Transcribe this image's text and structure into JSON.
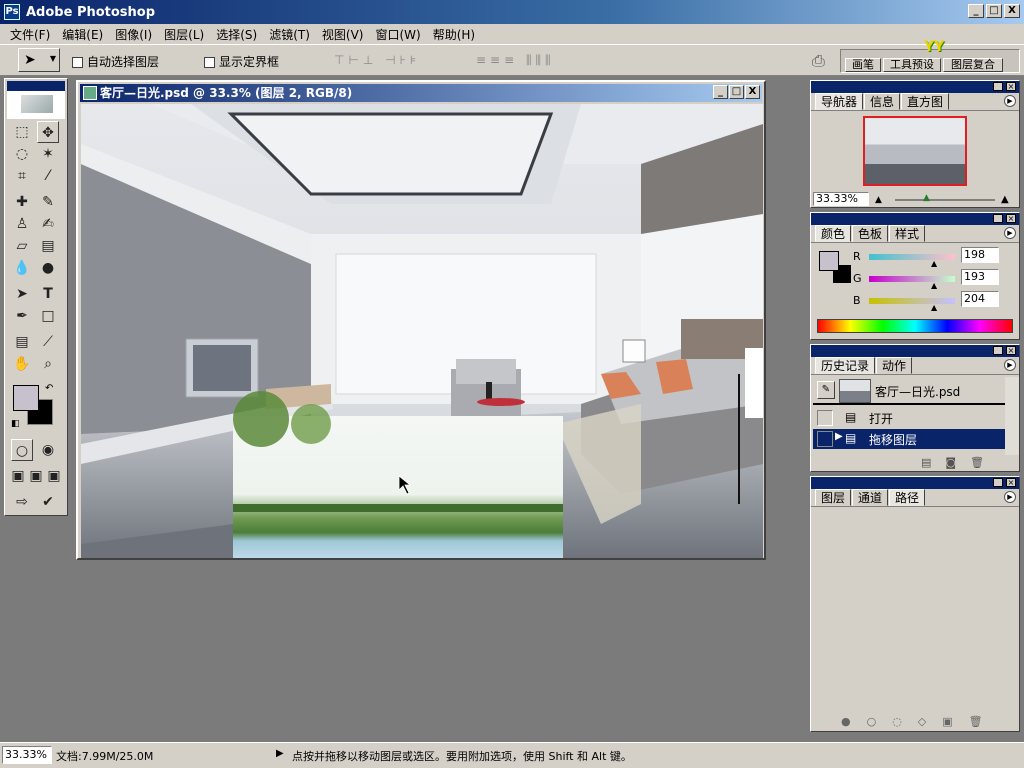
{
  "app": {
    "title": "Adobe Photoshop",
    "win_min": "_",
    "win_max": "□",
    "win_close": "X"
  },
  "menu": [
    "文件(F)",
    "编辑(E)",
    "图像(I)",
    "图层(L)",
    "选择(S)",
    "滤镜(T)",
    "视图(V)",
    "窗口(W)",
    "帮助(H)"
  ],
  "options": {
    "auto_select": "自动选择图层",
    "show_bounds": "显示定界框",
    "well_tabs": [
      "画笔",
      "工具预设",
      "图层复合"
    ]
  },
  "document": {
    "title": "客厅—日光.psd @ 33.3% (图层 2, RGB/8)"
  },
  "navigator": {
    "tabs": [
      "导航器",
      "信息",
      "直方图"
    ],
    "zoom": "33.33%"
  },
  "color": {
    "tabs": [
      "颜色",
      "色板",
      "样式"
    ],
    "r_label": "R",
    "g_label": "G",
    "b_label": "B",
    "r": "198",
    "g": "193",
    "b": "204",
    "fg": "#c6c1cc",
    "bg": "#000000"
  },
  "history": {
    "tabs": [
      "历史记录",
      "动作"
    ],
    "snapshot": "客厅—日光.psd",
    "items": [
      "打开",
      "拖移图层"
    ]
  },
  "layers": {
    "tabs": [
      "图层",
      "通道",
      "路径"
    ]
  },
  "status": {
    "zoom": "33.33%",
    "doc": "文档:7.99M/25.0M",
    "hint": "点按并拖移以移动图层或选区。要用附加选项，使用 Shift 和 Alt 键。"
  }
}
